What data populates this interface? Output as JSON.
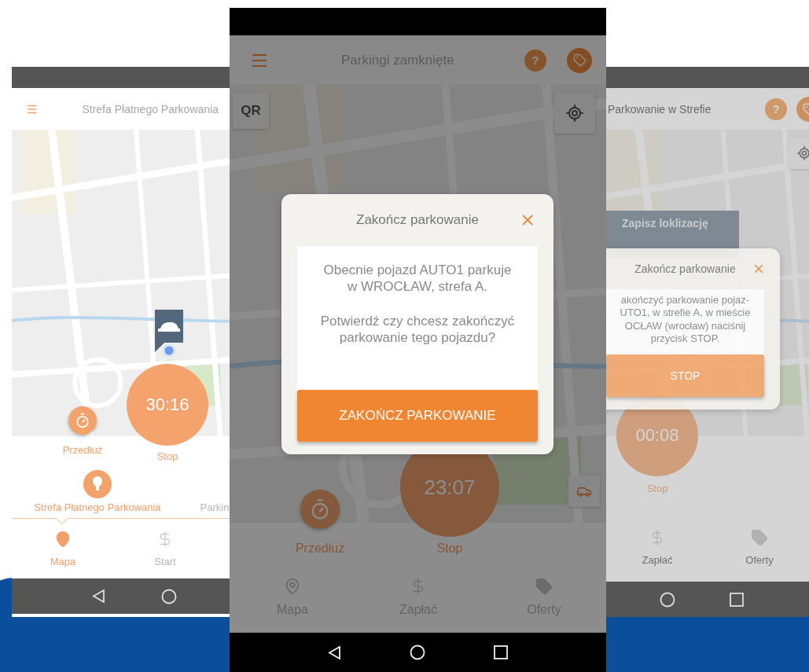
{
  "left_phone": {
    "title": "Strefa Płatnego Parkowania",
    "extend_label": "Przedłuż",
    "timer": "30:16",
    "timer_label": "Stop",
    "zone_tabs": [
      {
        "label": "Strefa Płatnego Parkowania",
        "selected": true
      },
      {
        "label": "Parkin",
        "selected": false
      }
    ],
    "nav": [
      {
        "kind": "pin",
        "label": "Mapa",
        "selected": true
      },
      {
        "kind": "dollar",
        "label": "Start",
        "selected": false
      }
    ]
  },
  "center_phone": {
    "title": "Parkingi zamknięte",
    "help": "?",
    "qr": "QR",
    "extend_label": "Przedłuż",
    "timer": "23:07",
    "timer_label": "Stop",
    "nav": [
      {
        "kind": "pin",
        "label": "Mapa",
        "selected": false
      },
      {
        "kind": "dollar",
        "label": "Zapłać",
        "selected": false
      },
      {
        "kind": "tag",
        "label": "Oferty",
        "selected": false
      }
    ],
    "dialog": {
      "title": "Zakończ parkowanie",
      "paragraphs": [
        "Obecnie pojazd AUTO1 parkuje\nw WROCŁAW, strefa A.",
        "Potwierdź czy chcesz zakończyć\nparkowanie tego pojazdu?"
      ],
      "button": "ZAKOŃCZ PARKOWANIE"
    }
  },
  "right_phone": {
    "title": "Parkowanie w Strefie",
    "help": "?",
    "save_panel_title": "Zapisz loklizację",
    "dialog": {
      "title": "Zakończ parkowanie",
      "paragraphs": [
        "akończyć parkowanie pojaz-\nUTO1, w strefie A, w mieście\nOCŁAW (wrocław) naciśnij\nprzycisk STOP."
      ],
      "button": "STOP"
    },
    "timer": "00:08",
    "timer_label": "Stop",
    "nav": [
      {
        "kind": "dollar",
        "label": "Zapłać",
        "selected": false
      },
      {
        "kind": "tag",
        "label": "Oferty",
        "selected": false
      }
    ]
  }
}
